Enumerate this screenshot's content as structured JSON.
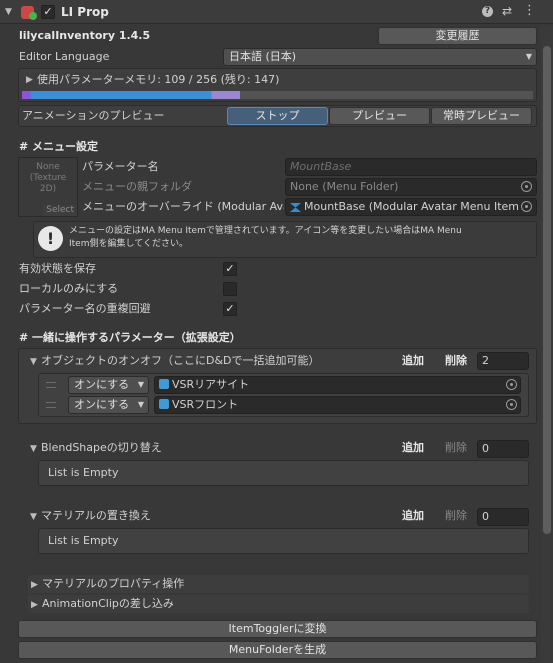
{
  "header": {
    "title": "LI Prop",
    "enabled": true,
    "help_icon": "help-icon",
    "settings_icon": "sliders-icon",
    "menu_icon": "kebab-menu-icon"
  },
  "package": {
    "name": "lilycalInventory 1.4.5",
    "changelog_button": "変更履歴"
  },
  "editor_language": {
    "label": "Editor Language",
    "value": "日本語 (日本)"
  },
  "param_memory": {
    "label": "使用パラメーターメモリ: 109 / 256 (残り: 147)",
    "used": 109,
    "total": 256,
    "remaining": 147,
    "colors": {
      "purple": "#8a55d8",
      "blue": "#3b8fd6",
      "light_purple": "#9a88d0",
      "empty": "#535353"
    }
  },
  "animation_preview": {
    "label": "アニメーションのプレビュー",
    "buttons": [
      "ストップ",
      "プレビュー",
      "常時プレビュー"
    ],
    "active_index": 0
  },
  "menu_settings": {
    "heading": "# メニュー設定",
    "texture": {
      "line1": "None",
      "line2": "(Texture",
      "line3": "2D)",
      "select": "Select"
    },
    "param_name_label": "パラメーター名",
    "param_name_placeholder": "MountBase",
    "parent_folder_label": "メニューの親フォルダ",
    "parent_folder_value": "None (Menu Folder)",
    "override_label": "メニューのオーバーライド (Modular Avatar",
    "override_value": "MountBase (Modular Avatar Menu Item",
    "info_text_1": "メニューの設定はMA Menu Itemで管理されています。アイコン等を変更したい場合はMA Menu",
    "info_text_2": "Item側を編集してください。"
  },
  "toggles": [
    {
      "label": "有効状態を保存",
      "checked": true
    },
    {
      "label": "ローカルのみにする",
      "checked": false
    },
    {
      "label": "パラメーター名の重複回避",
      "checked": true
    }
  ],
  "params": {
    "heading": "# 一緒に操作するパラメーター（拡張設定）",
    "object_toggle": {
      "label": "オブジェクトのオンオフ（ここにD&Dで一括追加可能）",
      "add": "追加",
      "delete": "削除",
      "count": "2",
      "items": [
        {
          "mode": "オンにする",
          "target": "VSRリアサイト"
        },
        {
          "mode": "オンにする",
          "target": "VSRフロント"
        }
      ]
    },
    "blendshape": {
      "label": "BlendShapeの切り替え",
      "add": "追加",
      "delete": "削除",
      "count": "0",
      "empty": "List is Empty"
    },
    "material_replace": {
      "label": "マテリアルの置き換え",
      "add": "追加",
      "delete": "削除",
      "count": "0",
      "empty": "List is Empty"
    },
    "material_property": {
      "label": "マテリアルのプロパティ操作"
    },
    "anim_clip": {
      "label": "AnimationClipの差し込み"
    }
  },
  "footer": {
    "convert_button": "ItemTogglerに変換",
    "generate_button": "MenuFolderを生成"
  }
}
